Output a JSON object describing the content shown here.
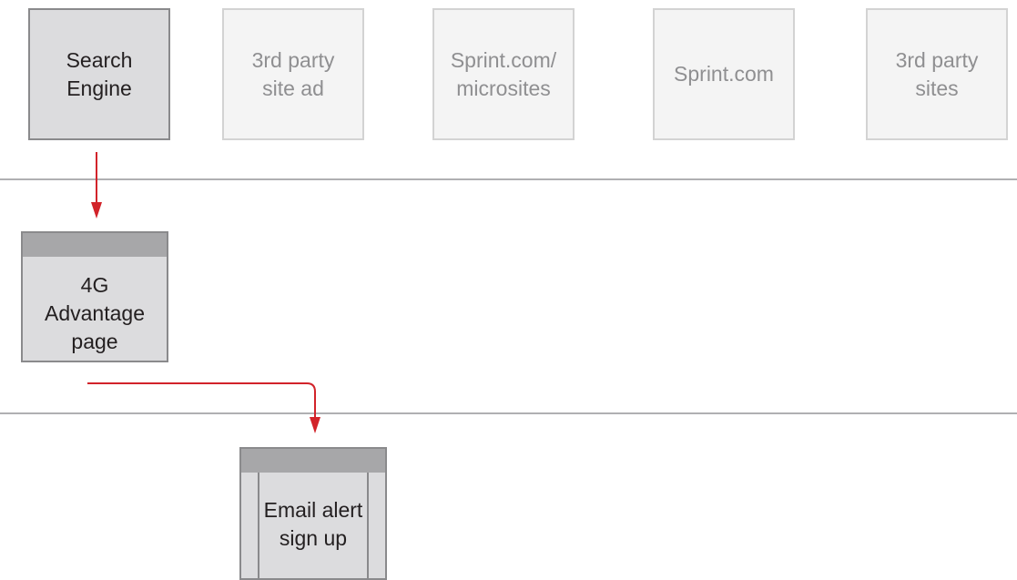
{
  "sources": [
    {
      "label": "Search\nEngine",
      "state": "active"
    },
    {
      "label": "3rd party\nsite ad",
      "state": "inactive"
    },
    {
      "label": "Sprint.com/\nmicrosites",
      "state": "inactive"
    },
    {
      "label": "Sprint.com",
      "state": "inactive"
    },
    {
      "label": "3rd party\nsites",
      "state": "inactive"
    }
  ],
  "pages": {
    "advantage": {
      "label": "4G\nAdvantage\npage"
    },
    "email": {
      "label": "Email alert\nsign up"
    }
  },
  "colors": {
    "arrow": "#d2232a",
    "active_box": "#dcdcde",
    "inactive_box": "#f4f4f4",
    "header_bar": "#a7a7a9"
  }
}
